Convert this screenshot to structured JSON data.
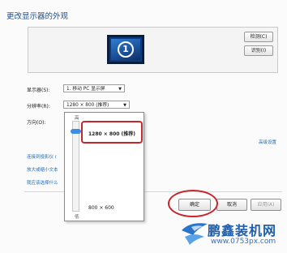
{
  "header": {
    "title": "更改显示器的外观"
  },
  "preview": {
    "monitor_number": "1"
  },
  "buttons": {
    "detect": "检测(C)",
    "identify": "识别(I)"
  },
  "fields": {
    "display_label": "显示器(S):",
    "display_value": "1. 移动 PC 显示屏",
    "resolution_label": "分辨率(R):",
    "resolution_value": "1280 × 800 (推荐)",
    "orientation_label": "方向(O):"
  },
  "resolution_dropdown": {
    "high_label": "高",
    "low_label": "低",
    "selected_option": "1280 × 800 (推荐)",
    "min_option": "800 × 600",
    "slider_level": 1.0
  },
  "links": {
    "advanced_settings": "高级设置",
    "connect_projector": "连接到投影仪 (",
    "text_size": "放大或缩小文本",
    "which_settings": "我应该选择什么"
  },
  "dialog": {
    "ok": "确定",
    "cancel": "取消",
    "apply": "应用(A)"
  },
  "watermark": {
    "brand": "鹏鑫装机网",
    "url": "www.0753px.com"
  },
  "colors": {
    "accent": "#1e4e8c",
    "highlight": "#c8242b",
    "slider": "#3a8ee6"
  }
}
